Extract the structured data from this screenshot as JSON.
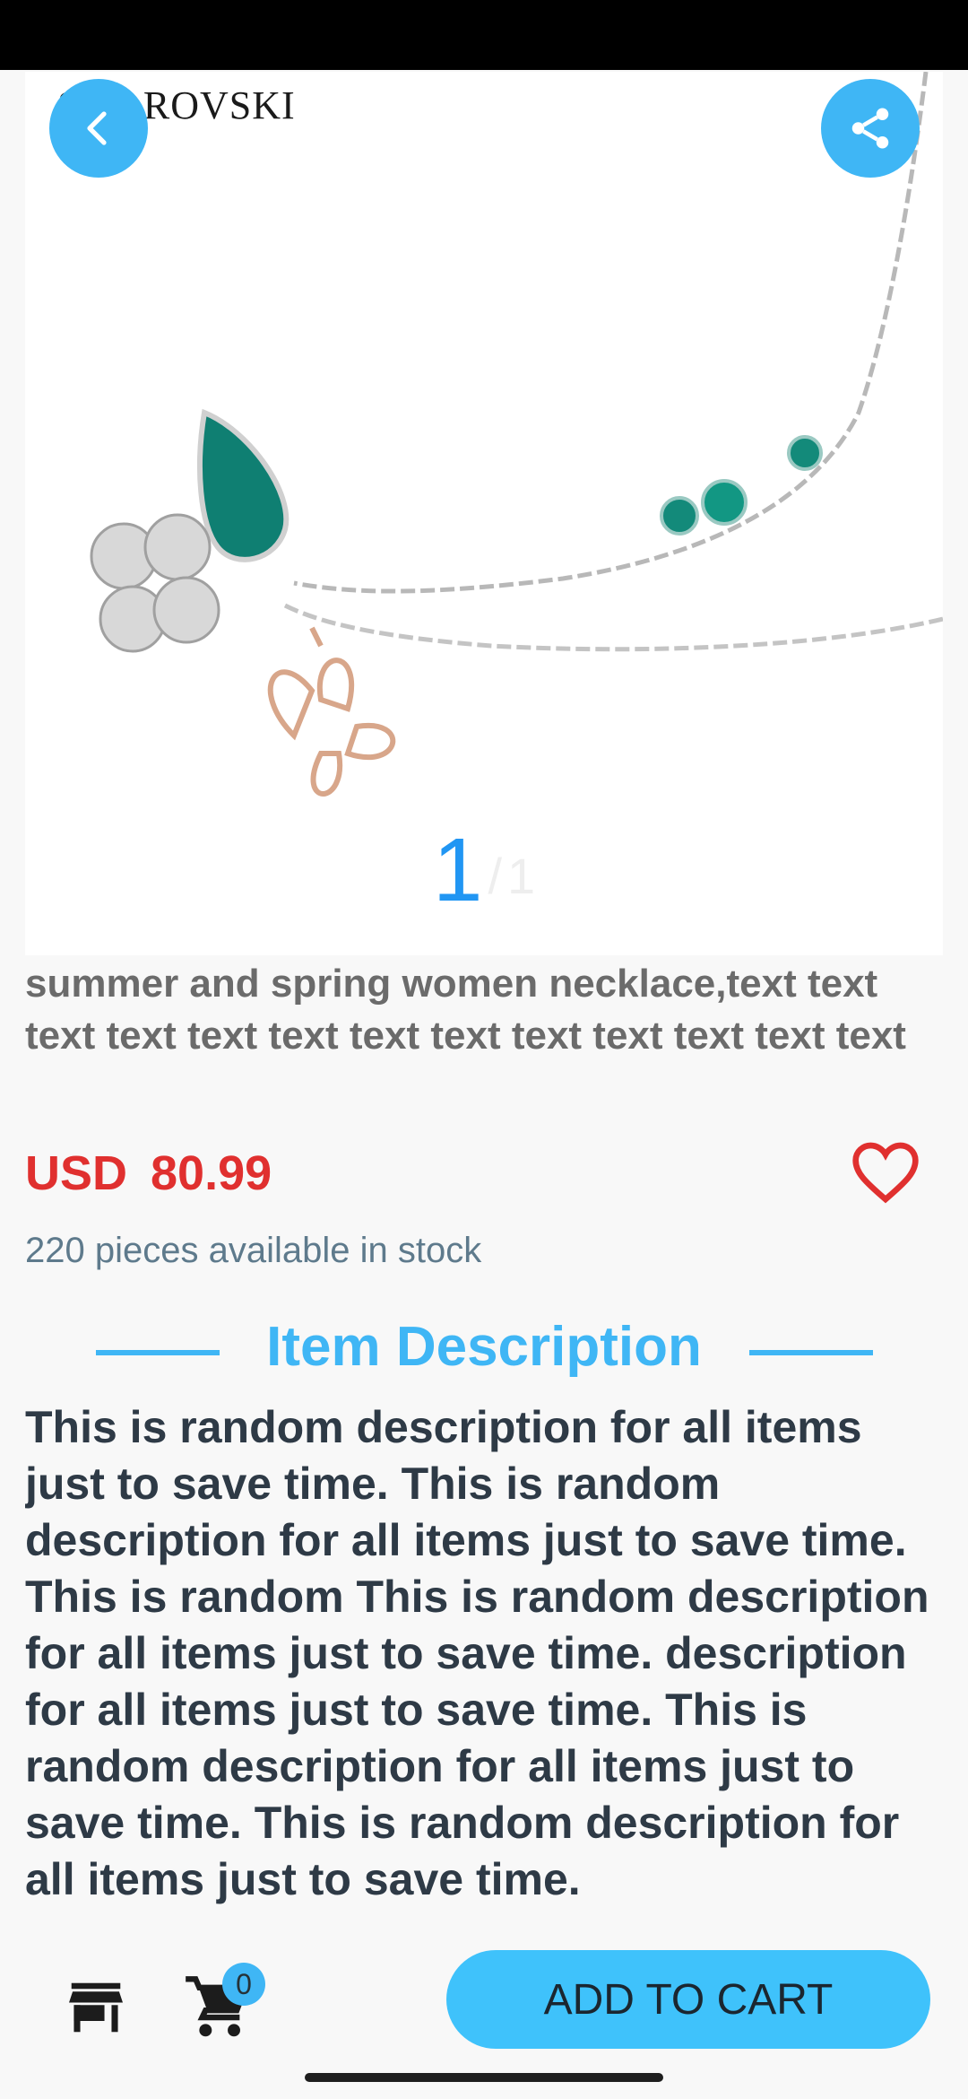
{
  "product": {
    "brand_logo_text": "SWAROVSKI",
    "image_pager": {
      "current": "1",
      "separator": "/",
      "total": "1"
    },
    "title": "summer and spring women necklace,text text text text text text text text text text text text text",
    "price": {
      "currency": "USD",
      "amount": "80.99"
    },
    "stock_text": "220 pieces available in stock"
  },
  "section": {
    "title": "Item Description"
  },
  "description": "This is random description for all items just to save time. This is random description for all items just to save time. This is random This is random description for all items just to save time. description for all items just to save time. This is random description for all items just to save time. This is random description for all items just to save time.",
  "bottom_bar": {
    "cart_count": "0",
    "add_to_cart_label": "ADD TO CART"
  },
  "icons": {
    "back": "chevron-left-icon",
    "share": "share-icon",
    "favorite": "heart-outline-icon",
    "store": "store-icon",
    "cart": "shopping-cart-icon"
  },
  "colors": {
    "accent": "#3fb6f5",
    "price": "#e0302f",
    "add_to_cart_bg": "#3fc2fb"
  }
}
